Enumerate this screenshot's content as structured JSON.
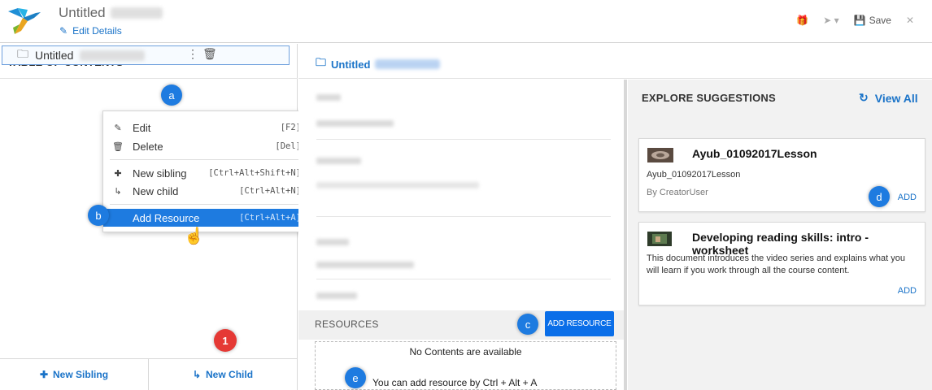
{
  "header": {
    "title": "Untitled",
    "edit_details": "Edit Details",
    "save": "Save"
  },
  "toc": {
    "title": "TABLE OF CONTENTS",
    "node_label": "Untitled"
  },
  "context_menu": {
    "items": [
      {
        "label": "Edit",
        "shortcut": "[F2]",
        "icon": "pencil-icon"
      },
      {
        "label": "Delete",
        "shortcut": "[Del]",
        "icon": "trash-icon"
      },
      {
        "label": "New sibling",
        "shortcut": "[Ctrl+Alt+Shift+N]",
        "icon": "plus-icon"
      },
      {
        "label": "New child",
        "shortcut": "[Ctrl+Alt+N]",
        "icon": "child-arrow-icon"
      },
      {
        "label": "Add Resource",
        "shortcut": "[Ctrl+Alt+A]",
        "icon": ""
      }
    ]
  },
  "bottom_bar": {
    "new_sibling": "New Sibling",
    "new_child": "New Child"
  },
  "main": {
    "breadcrumb": "Untitled",
    "resources_label": "RESOURCES",
    "add_resource_button": "ADD RESOURCE",
    "empty_message": "No Contents are available",
    "add_hint": "You can add resource by Ctrl + Alt + A"
  },
  "suggestions": {
    "title": "EXPLORE SUGGESTIONS",
    "view_all": "View All",
    "cards": [
      {
        "title": "Ayub_01092017Lesson",
        "subtitle": "Ayub_01092017Lesson",
        "author": "By CreatorUser",
        "add": "ADD"
      },
      {
        "title": "Developing reading skills: intro - worksheet",
        "description": "This document introduces the video series and explains what you will learn if you work through all the course content.",
        "add": "ADD"
      }
    ]
  },
  "annotations": {
    "a": "a",
    "b": "b",
    "c": "c",
    "d": "d",
    "e": "e",
    "one": "1"
  },
  "colors": {
    "accent": "#1e7be0",
    "primary_button": "#0a6ee8",
    "link": "#1a73c8",
    "marker_red": "#e53935"
  }
}
